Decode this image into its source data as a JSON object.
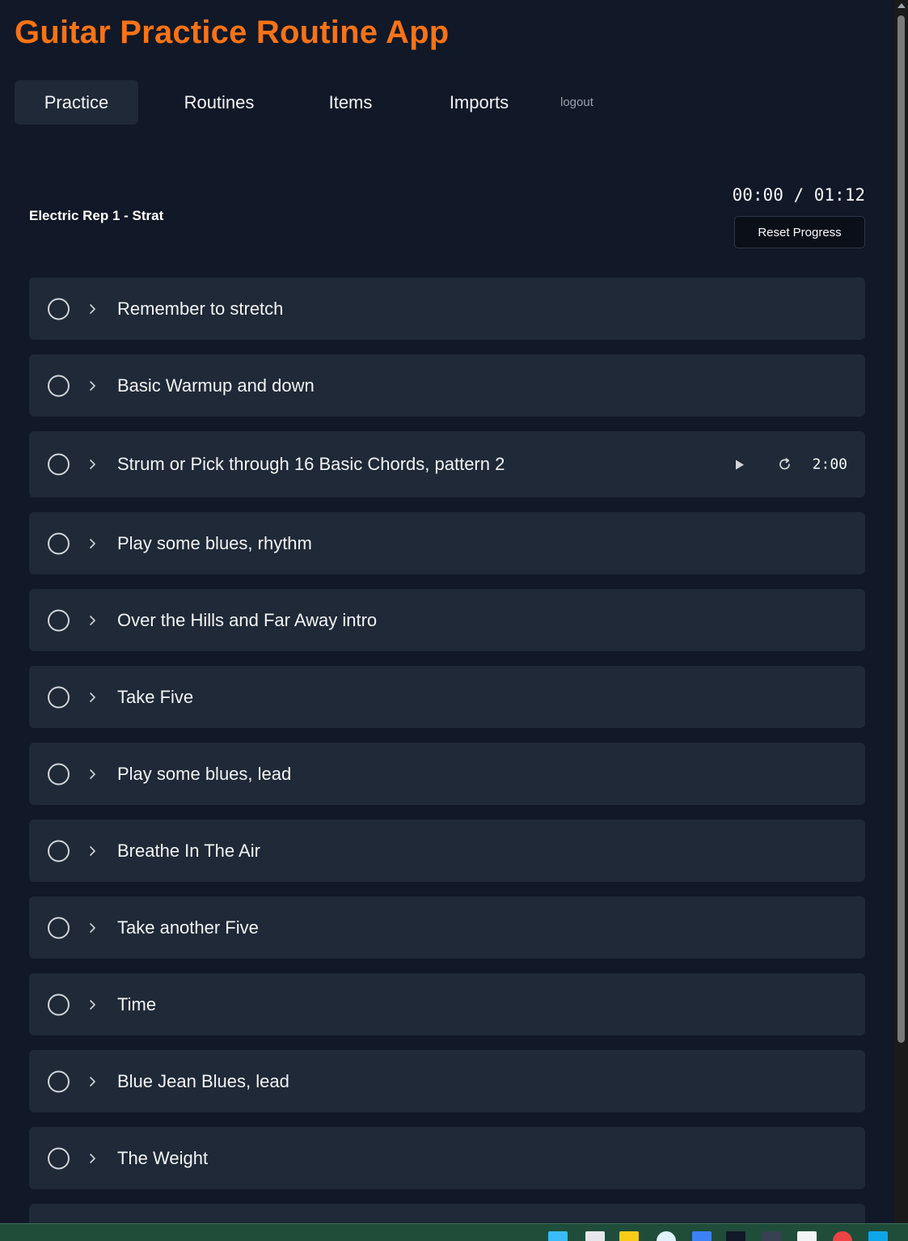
{
  "app": {
    "title": "Guitar Practice Routine App"
  },
  "nav": {
    "tabs": [
      "Practice",
      "Routines",
      "Items",
      "Imports"
    ],
    "logout": "logout"
  },
  "routine": {
    "name": "Electric Rep 1 - Strat",
    "timer": "00:00 / 01:12",
    "reset_label": "Reset Progress"
  },
  "items": [
    {
      "label": "Remember to stretch"
    },
    {
      "label": "Basic Warmup and down"
    },
    {
      "label": "Strum or Pick through 16 Basic Chords, pattern 2",
      "duration": "2:00"
    },
    {
      "label": "Play some blues, rhythm"
    },
    {
      "label": "Over the Hills and Far Away intro"
    },
    {
      "label": "Take Five"
    },
    {
      "label": "Play some blues, lead"
    },
    {
      "label": "Breathe In The Air"
    },
    {
      "label": "Take another Five"
    },
    {
      "label": "Time"
    },
    {
      "label": "Blue Jean Blues, lead"
    },
    {
      "label": "The Weight"
    },
    {
      "label": ""
    }
  ],
  "colors": {
    "background": "#111827",
    "card": "#1f2937",
    "accent": "#f97316",
    "text": "#f3f4f6",
    "muted": "#9ca3af"
  },
  "icons": {
    "item_status": "circle-outline-icon",
    "item_expand": "chevron-right-icon",
    "play": "play-icon",
    "restart": "restart-icon"
  }
}
